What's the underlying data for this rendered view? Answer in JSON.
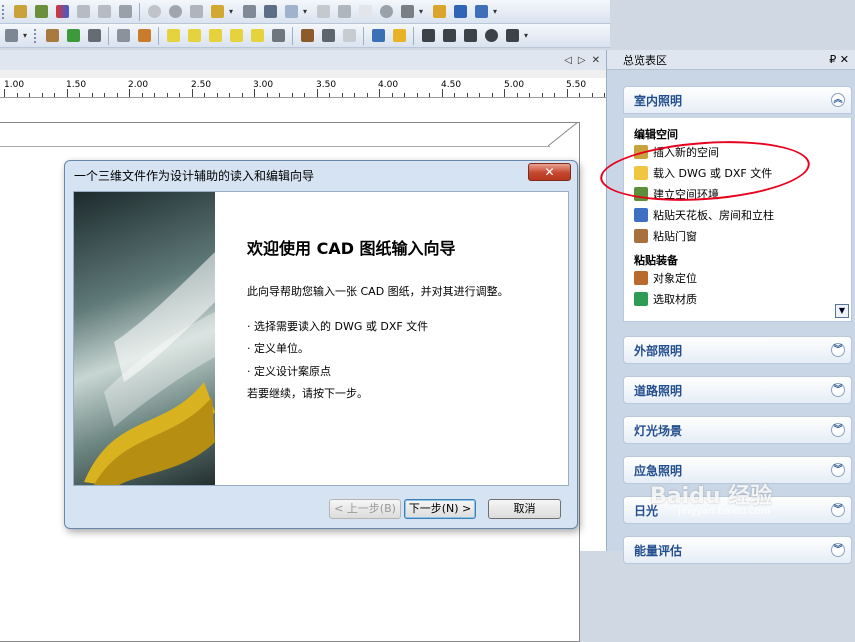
{
  "canvas": {
    "nav": [
      "◁",
      "▷",
      "✕"
    ],
    "ruler_labels": [
      "1.00",
      "1.50",
      "2.00",
      "2.50",
      "3.00",
      "3.50",
      "4.00",
      "4.50",
      "5.00",
      "5.50"
    ]
  },
  "dialog": {
    "title": "一个三维文件作为设计辅助的读入和编辑向导",
    "close": "✕",
    "heading": "欢迎使用 CAD 图纸输入向导",
    "intro": "此向导帮助您输入一张 CAD 图纸，并对其进行调整。",
    "steps": [
      "· 选择需要读入的 DWG 或 DXF 文件",
      "· 定义单位。",
      "· 定义设计案原点"
    ],
    "continue": "若要继续，请按下一步。",
    "buttons": {
      "back": "< 上一步(B)",
      "next": "下一步(N) >",
      "cancel": "取消"
    }
  },
  "panel": {
    "title": "总览表区",
    "pin": "₽ ✕",
    "sections": [
      {
        "label": "室内照明",
        "expanded": true
      },
      {
        "label": "外部照明"
      },
      {
        "label": "道路照明"
      },
      {
        "label": "灯光场景"
      },
      {
        "label": "应急照明"
      },
      {
        "label": "日光"
      },
      {
        "label": "能量评估"
      }
    ],
    "subsection1": "编辑空间",
    "items1": [
      "插入新的空间",
      "载入 DWG 或 DXF 文件",
      "建立空间环境",
      "粘贴天花板、房间和立柱",
      "粘贴门窗"
    ],
    "subsection2": "粘贴装备",
    "items2": [
      "对象定位",
      "选取材质"
    ]
  },
  "watermark": {
    "main": "Baidu 经验",
    "sub": "jingyan.baidu.com"
  },
  "colors": {
    "accent": "#244f8f",
    "highlight_circle": "#e8001c",
    "close_red": "#c4472e"
  }
}
